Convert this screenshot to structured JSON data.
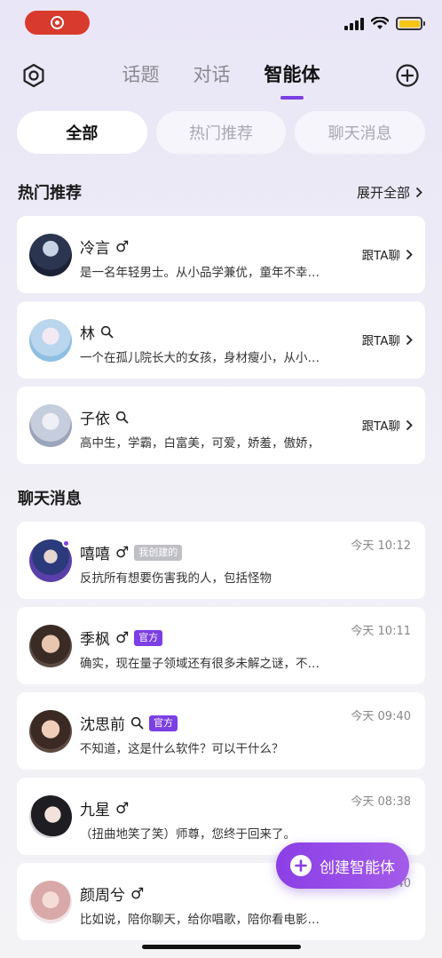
{
  "status_bar": {
    "battery_color": "#f5c518",
    "recording_color": "#d93a2e"
  },
  "topnav": {
    "tabs": [
      {
        "label": "话题",
        "active": false
      },
      {
        "label": "对话",
        "active": false
      },
      {
        "label": "智能体",
        "active": true
      }
    ]
  },
  "filters": [
    {
      "label": "全部",
      "active": true
    },
    {
      "label": "热门推荐",
      "active": false
    },
    {
      "label": "聊天消息",
      "active": false
    }
  ],
  "hot": {
    "title": "热门推荐",
    "expand_label": "展开全部",
    "items": [
      {
        "name": "冷言",
        "gender": "♂",
        "desc": "是一名年轻男士。从小品学兼优，童年不幸…",
        "action": "跟TA聊"
      },
      {
        "name": "林",
        "gender": "",
        "desc": "一个在孤儿院长大的女孩，身材瘦小，从小…",
        "action": "跟TA聊"
      },
      {
        "name": "子依",
        "gender": "",
        "desc": "高中生，学霸，白富美，可爱，娇羞，傲娇，",
        "action": "跟TA聊"
      }
    ]
  },
  "messages": {
    "title": "聊天消息",
    "items": [
      {
        "name": "嘻嘻",
        "gender": "♂",
        "badge": "我创建的",
        "desc": "反抗所有想要伤害我的人，包括怪物",
        "time": "今天 10:12"
      },
      {
        "name": "季枫",
        "gender": "♂",
        "badge": "官方",
        "desc": "确实，现在量子领域还有很多未解之谜，不…",
        "time": "今天 10:11"
      },
      {
        "name": "沈思前",
        "gender": "",
        "badge": "官方",
        "desc": "不知道，这是什么软件？可以干什么？",
        "time": "今天 09:40"
      },
      {
        "name": "九星",
        "gender": "♂",
        "badge": "",
        "desc": "（扭曲地笑了笑）师尊，您终于回来了。",
        "time": "今天 08:38"
      },
      {
        "name": "颜周兮",
        "gender": "♂",
        "badge": "",
        "desc": "比如说，陪你聊天，给你唱歌，陪你看电影…",
        "time": "40"
      }
    ]
  },
  "fab": {
    "label": "创建智能体"
  },
  "accent_color": "#7b3fe4"
}
